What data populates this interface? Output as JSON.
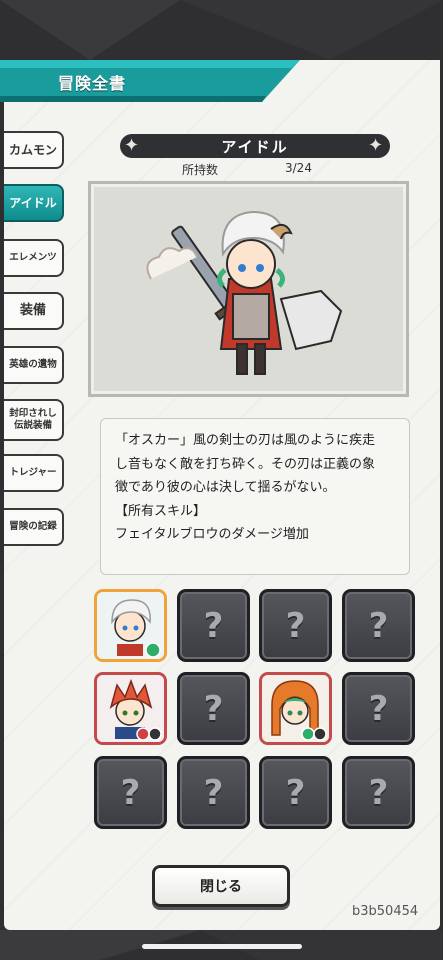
{
  "header": {
    "title": "冒険全書"
  },
  "sidebar": {
    "items": [
      {
        "label": "カムモン",
        "active": false
      },
      {
        "label": "アイドル",
        "active": true
      },
      {
        "label": "エレメンツ",
        "active": false
      },
      {
        "label": "装備",
        "active": false
      },
      {
        "label": "英雄の遺物",
        "active": false
      },
      {
        "label_line1": "封印されし",
        "label_line2": "伝説装備",
        "active": false
      },
      {
        "label": "トレジャー",
        "active": false
      },
      {
        "label": "冒険の記録",
        "active": false
      }
    ]
  },
  "main": {
    "title": "アイドル",
    "owned_label": "所持数",
    "owned_value": "3/24",
    "description": [
      "「オスカー」風の剣士の刃は風のように疾走",
      "し音もなく敵を打ち砕く。その刃は正義の象",
      "徴であり彼の心は決して揺るがない。",
      "【所有スキル】",
      "フェイタルブロウのダメージ増加"
    ],
    "locked_glyph": "?",
    "grid": [
      [
        "owned-selected",
        "locked",
        "locked",
        "locked"
      ],
      [
        "owned",
        "locked",
        "owned",
        "locked"
      ],
      [
        "locked",
        "locked",
        "locked",
        "locked"
      ]
    ]
  },
  "close_button": {
    "label": "閉じる"
  },
  "player_id": "b3b50454",
  "colors": {
    "accent": "#1fa3a3",
    "panel": "#f3f3ef",
    "slot_locked": "#4a4b50",
    "slot_owned_border": "#c24a4a",
    "selected_border": "#f2a23b"
  }
}
